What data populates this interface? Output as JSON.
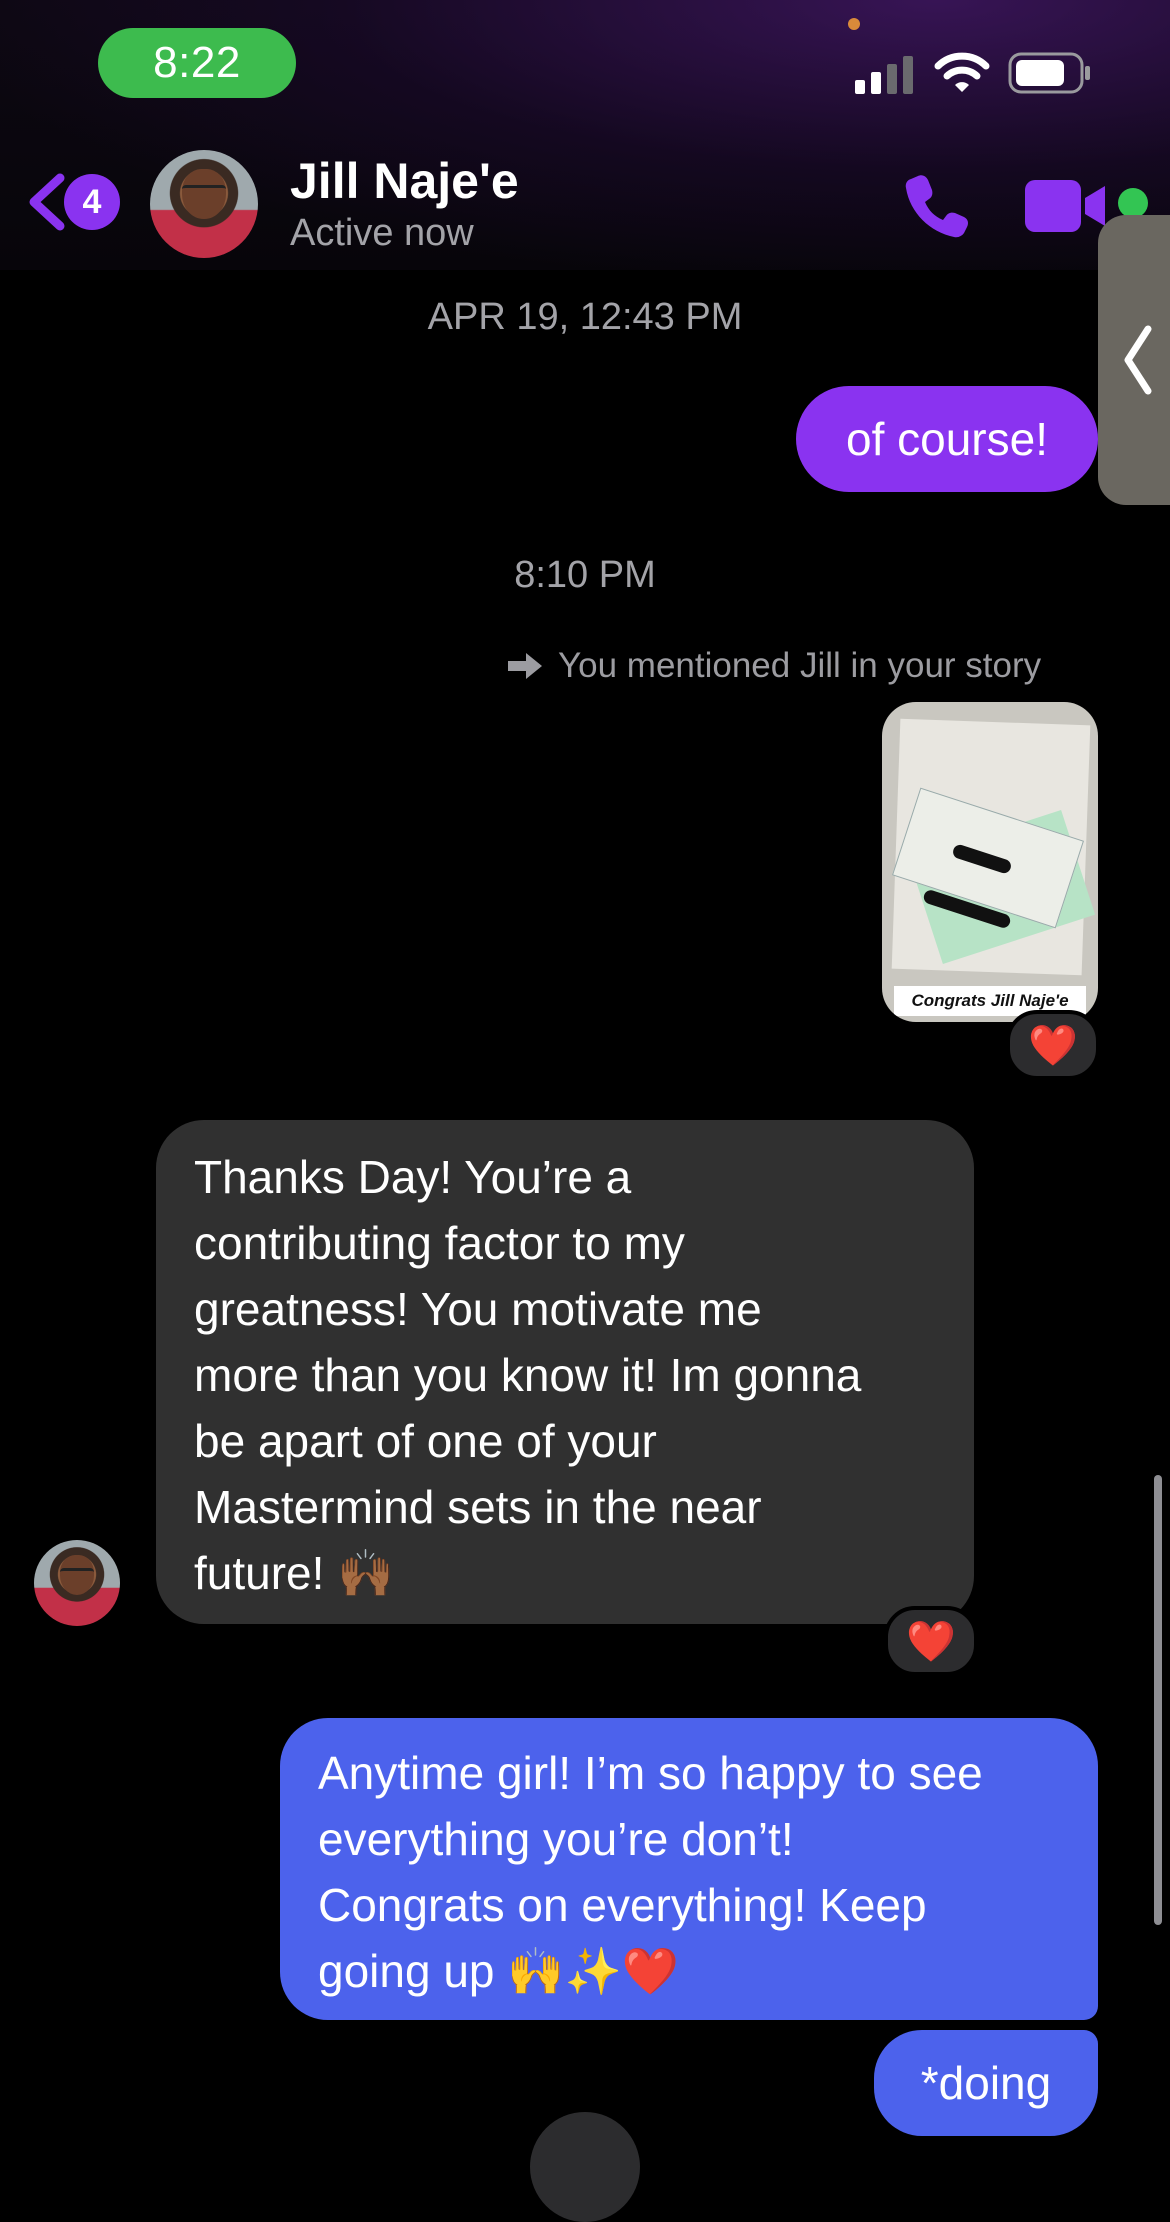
{
  "status_bar": {
    "time": "8:22"
  },
  "header": {
    "back_badge_count": "4",
    "contact_name": "Jill Naje'e",
    "contact_status": "Active now",
    "icons": [
      "back-chevron-icon",
      "phone-icon",
      "video-camera-icon",
      "online-status-dot"
    ]
  },
  "conversation": {
    "timestamp_1": "APR 19, 12:43 PM",
    "message_1": "of course!",
    "timestamp_2": "8:10 PM",
    "story_note": "You mentioned Jill in your story",
    "story_caption": "Congrats Jill Naje'e",
    "message_2_lines": [
      "Thanks Day! You’re a",
      "contributing factor to my",
      "greatness! You motivate me",
      "more than you know it! Im gonna",
      "be apart of one of your",
      "Mastermind sets in the near",
      "future! 🙌🏾"
    ],
    "message_3_lines": [
      "Anytime girl! I’m so happy to see",
      "everything you’re don’t!",
      "Congrats on everything! Keep",
      "going up 🙌✨❤️"
    ],
    "message_4": "*doing",
    "reaction_emoji": "❤️"
  },
  "colors": {
    "accent_purple": "#8a33f0",
    "outgoing_blue": "#4c62ec",
    "incoming_gray": "#303030",
    "time_pill_green": "#3dbb4e",
    "online_green": "#33c553"
  }
}
